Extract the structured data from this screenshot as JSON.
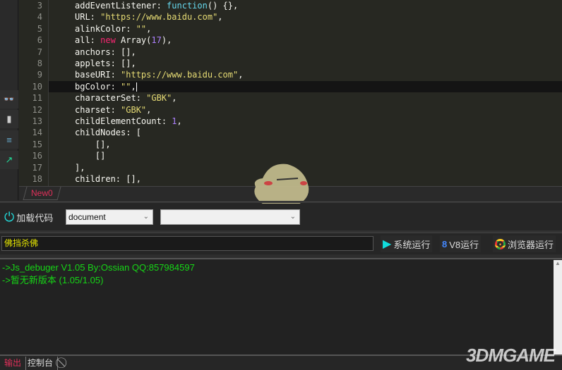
{
  "editor": {
    "line_numbers": [
      "3",
      "4",
      "5",
      "6",
      "7",
      "8",
      "9",
      "10",
      "11",
      "12",
      "13",
      "14",
      "15",
      "16",
      "17",
      "18"
    ],
    "active_line_index": 7,
    "lines": [
      [
        [
          "addEventListener: ",
          ""
        ],
        [
          "function",
          "t-fn"
        ],
        [
          "() {},",
          ""
        ]
      ],
      [
        [
          "URL: ",
          ""
        ],
        [
          "\"https://www.baidu.com\"",
          "t-str"
        ],
        [
          ",",
          ""
        ]
      ],
      [
        [
          "alinkColor: ",
          ""
        ],
        [
          "\"\"",
          "t-str"
        ],
        [
          ",",
          ""
        ]
      ],
      [
        [
          "all: ",
          ""
        ],
        [
          "new",
          "t-kw"
        ],
        [
          " Array(",
          ""
        ],
        [
          "17",
          "t-num"
        ],
        [
          "),",
          ""
        ]
      ],
      [
        [
          "anchors: [],",
          ""
        ]
      ],
      [
        [
          "applets: [],",
          ""
        ]
      ],
      [
        [
          "baseURI: ",
          ""
        ],
        [
          "\"https://www.baidu.com\"",
          "t-str"
        ],
        [
          ",",
          ""
        ]
      ],
      [
        [
          "bgColor: ",
          ""
        ],
        [
          "\"\"",
          "t-str"
        ],
        [
          ",",
          ""
        ]
      ],
      [
        [
          "characterSet: ",
          ""
        ],
        [
          "\"GBK\"",
          "t-str"
        ],
        [
          ",",
          ""
        ]
      ],
      [
        [
          "charset: ",
          ""
        ],
        [
          "\"GBK\"",
          "t-str"
        ],
        [
          ",",
          ""
        ]
      ],
      [
        [
          "childElementCount: ",
          ""
        ],
        [
          "1",
          "t-num"
        ],
        [
          ",",
          ""
        ]
      ],
      [
        [
          "childNodes: [",
          ""
        ]
      ],
      [
        [
          "    [],",
          ""
        ]
      ],
      [
        [
          "    []",
          ""
        ]
      ],
      [
        [
          "],",
          ""
        ]
      ],
      [
        [
          "children: [],",
          ""
        ]
      ]
    ],
    "tab": "New0"
  },
  "sidebar": {
    "icons": [
      "binoculars-icon",
      "archive-icon",
      "format-icon",
      "external-link-icon"
    ]
  },
  "toolbar": {
    "load_label": "加载代码",
    "select1_value": "document",
    "select2_value": ""
  },
  "runbar": {
    "input_value": "佛挡杀佛",
    "system_run": "系统运行",
    "v8_run": "V8运行",
    "browser_run": "浏览器运行"
  },
  "output": {
    "lines": [
      "->Js_debuger V1.05 By:Ossian QQ:857984597",
      "->暂无新版本 (1.05/1.05)"
    ]
  },
  "bottom_tabs": {
    "output": "输出",
    "console": "控制台"
  },
  "colors": {
    "accent_pink": "#e0305a",
    "output_green": "#16d616"
  },
  "watermark": "3DMGAME"
}
